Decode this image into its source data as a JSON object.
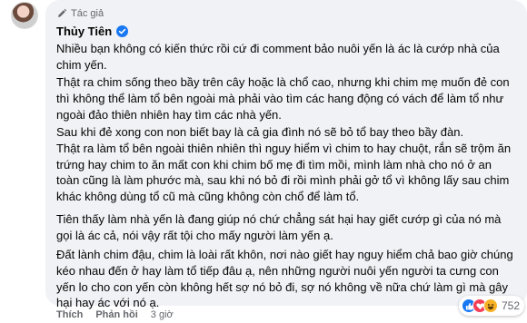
{
  "comment": {
    "author_tag": "Tác giả",
    "author_name": "Thủy Tiên",
    "paragraphs": [
      "Nhiều bạn không có kiến thức rồi cứ đi comment bảo nuôi yến là ác là cướp nhà của\nchim yến.",
      "Thật ra chim sống theo bầy trên cây hoặc là chổ cao, nhưng khi chim mẹ muốn đẻ con\nthì không thể làm tổ bên ngoài mà phải vào tìm các hang động có vách để làm tổ như\nngoài đảo thiên nhiên hay tìm các nhà yến.",
      "Sau khi đẻ xong con non biết bay là cả gia đình nó sẽ bỏ tổ bay theo bầy đàn.\nThật ra làm tổ bên ngoài thiên nhiên thì nguy hiểm vì chim to hay chuột, rắn sẽ trộm ăn\ntrứng hay chim to ăn mất con khi chim bố mẹ đi tìm mồi, mình làm nhà cho nó ở an\ntoàn cũng là làm phước mà, sau khi nó bỏ đi rồi mình phải gở tổ vì không lấy sau chim\nkhác không dùng tổ cũ mà cũng không còn chổ để làm tổ.",
      "Tiên thấy làm nhà yến là đang giúp nó chứ chẳng sát hại hay giết cướp gì của nó mà\ngọi là ác cả, nói vậy rất tội cho mấy người làm yến ạ.",
      "Đất lành chim đậu, chim là loài rất khôn, nơi nào giết hay nguy hiểm chả bao giờ chúng\nkéo nhau đến ở hay làm tổ tiếp đâu ạ, nên những người nuôi yến người ta cưng con\nyến lo cho con yến còn không hết sợ nó bỏ đi, sợ nó không về nữa chứ làm gì mà gây\nhại hay ác với nó ạ."
    ],
    "actions": {
      "like": "Thích",
      "reply": "Phản hồi",
      "time": "3 giờ"
    },
    "reactions": {
      "icons": [
        "like-icon",
        "love-icon",
        "haha-icon"
      ],
      "count": "752"
    }
  }
}
